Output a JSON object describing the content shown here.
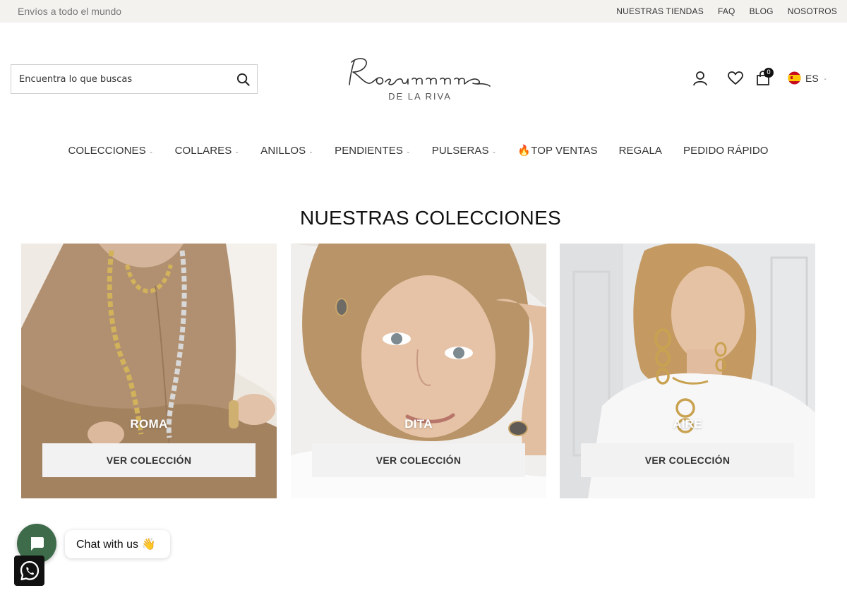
{
  "topbar": {
    "promo": "Envíos a todo el mundo",
    "links": [
      "NUESTRAS TIENDAS",
      "FAQ",
      "BLOG",
      "NOSOTROS"
    ]
  },
  "header": {
    "search_placeholder": "Encuentra lo que buscas",
    "logo_text": "Rosanne",
    "logo_sub": "DE LA RIVA",
    "cart_count": "0",
    "language": "ES"
  },
  "nav": {
    "items": [
      {
        "label": "COLECCIONES",
        "dropdown": true
      },
      {
        "label": "COLLARES",
        "dropdown": true
      },
      {
        "label": "ANILLOS",
        "dropdown": true
      },
      {
        "label": "PENDIENTES",
        "dropdown": true
      },
      {
        "label": "PULSERAS",
        "dropdown": true
      },
      {
        "label": "🔥TOP VENTAS",
        "dropdown": false
      },
      {
        "label": "REGALA",
        "dropdown": false
      },
      {
        "label": "PEDIDO RÁPIDO",
        "dropdown": false
      }
    ]
  },
  "collections": {
    "title": "NUESTRAS COLECCIONES",
    "cards": [
      {
        "name": "ROMA",
        "cta": "VER COLECCIÓN"
      },
      {
        "name": "DITA",
        "cta": "VER COLECCIÓN"
      },
      {
        "name": "AIRE",
        "cta": "VER COLECCIÓN"
      }
    ]
  },
  "chat": {
    "label": "Chat with us 👋"
  },
  "colors": {
    "topbar_bg": "#f4f2ef",
    "chat_green": "#3e6b4a",
    "cta_bg": "#f2f2f2"
  }
}
